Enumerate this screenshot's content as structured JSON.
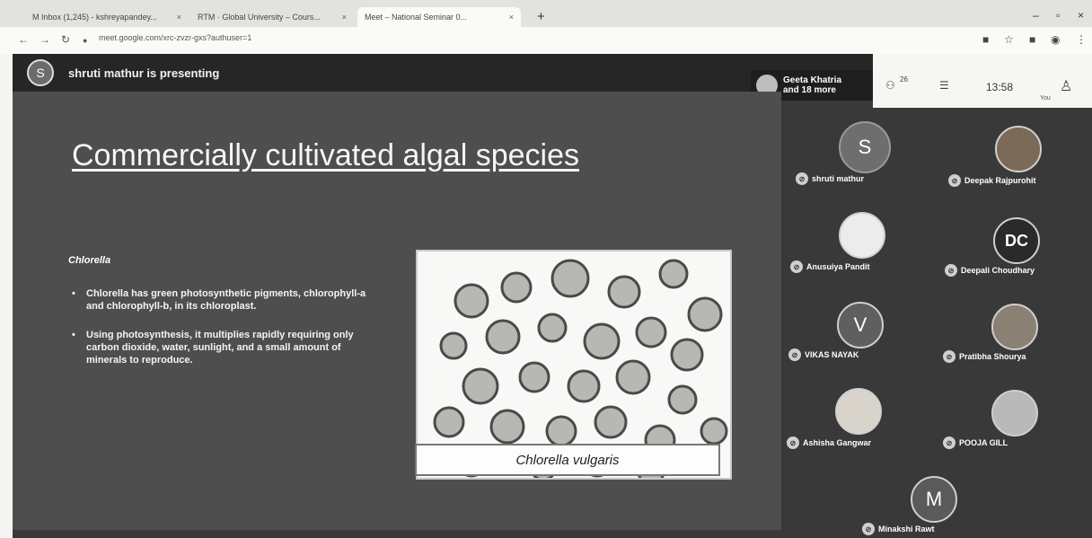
{
  "browser": {
    "tabs": [
      {
        "label": "M  Inbox (1,245) - kshreyapandey..."
      },
      {
        "label": "RTM · Global University – Cours..."
      },
      {
        "label": "Meet – National Seminar 0..."
      }
    ],
    "url": "meet.google.com/xrc-zvzr-gxs?authuser=1",
    "new_tab": "+"
  },
  "meet": {
    "presenter_initial": "S",
    "presenting_text": "shruti mathur is presenting",
    "speaker_chip": {
      "line1": "Geeta Khatria",
      "line2": "and 18 more"
    },
    "participant_count": "26",
    "time": "13:58",
    "you_label": "You"
  },
  "slide": {
    "title": "Commercially cultivated algal species",
    "subheading": "Chlorella",
    "bullets": [
      "Chlorella has green photosynthetic pigments, chlorophyll-a and chlorophyll-b, in its chloroplast.",
      "Using photosynthesis, it multiplies rapidly requiring only carbon dioxide, water, sunlight, and a small amount of minerals to reproduce."
    ],
    "image_caption": "Chlorella vulgaris"
  },
  "participants": [
    {
      "name": "shruti mathur",
      "initial": "S",
      "color": "#6e6e6e"
    },
    {
      "name": "Deepak Rajpurohit",
      "initial": "",
      "color": "#7c6a58"
    },
    {
      "name": "Anusuiya Pandit",
      "initial": "",
      "color": "#ececec"
    },
    {
      "name": "Deepali Choudhary",
      "initial": "DC",
      "color": "#2a2a2a"
    },
    {
      "name": "VIKAS NAYAK",
      "initial": "V",
      "color": "#5f5f5f"
    },
    {
      "name": "Pratibha Shourya",
      "initial": "",
      "color": "#8a8074"
    },
    {
      "name": "Ashisha Gangwar",
      "initial": "",
      "color": "#d8d4cc"
    },
    {
      "name": "POOJA GILL",
      "initial": "",
      "color": "#b9b9b9"
    },
    {
      "name": "Minakshi Rawt",
      "initial": "M",
      "color": "#5a5a5a"
    }
  ]
}
